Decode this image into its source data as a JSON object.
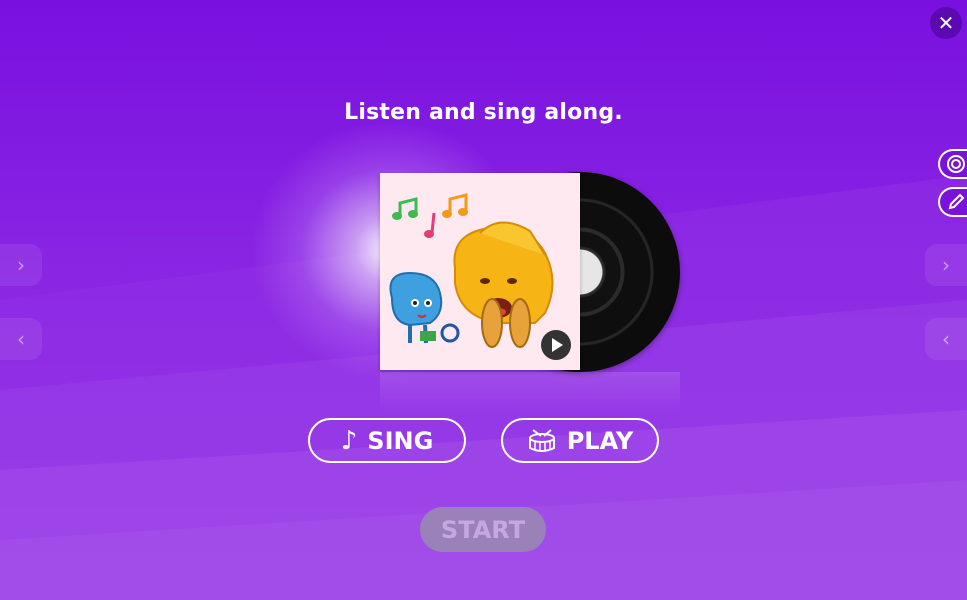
{
  "header": {
    "close_symbol": "✕"
  },
  "instruction": "Listen and sing along.",
  "album": {
    "play_icon": "play-icon"
  },
  "modes": [
    {
      "label": "SING",
      "icon": "music-note-icon",
      "glyph": "♪"
    },
    {
      "label": "PLAY",
      "icon": "drum-icon"
    }
  ],
  "start": {
    "label": "START",
    "enabled": false
  },
  "nav": {
    "left_symbol": "‹",
    "right_symbol": "›"
  },
  "side_tools": [
    "target-icon",
    "pencil-icon"
  ],
  "colors": {
    "background": "#8a15e6",
    "start_disabled": "#9a82b8",
    "accent_white": "#ffffff"
  }
}
